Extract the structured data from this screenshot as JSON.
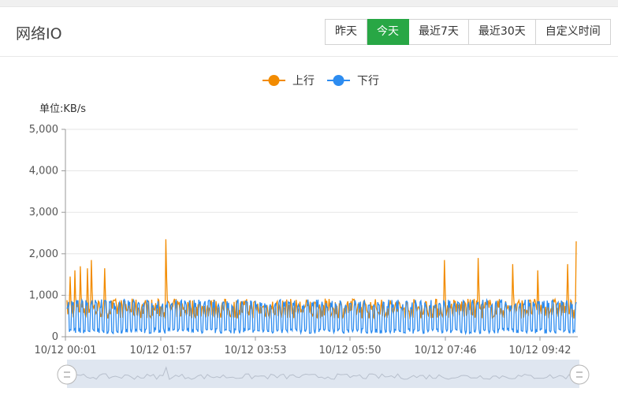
{
  "panel": {
    "title": "网络IO",
    "range_buttons": [
      {
        "label": "昨天",
        "active": false
      },
      {
        "label": "今天",
        "active": true
      },
      {
        "label": "最近7天",
        "active": false
      },
      {
        "label": "最近30天",
        "active": false
      },
      {
        "label": "自定义时间",
        "active": false
      }
    ]
  },
  "colors": {
    "upload": "#f28b00",
    "download": "#2d8cf0",
    "active_button": "#28a745"
  },
  "chart_data": {
    "type": "line",
    "unit_label": "单位:KB/s",
    "legend": [
      {
        "name": "上行",
        "color": "#f28b00"
      },
      {
        "name": "下行",
        "color": "#2d8cf0"
      }
    ],
    "ylim": [
      0,
      5000
    ],
    "y_ticks": [
      "0",
      "1,000",
      "2,000",
      "3,000",
      "4,000",
      "5,000"
    ],
    "x_ticks": [
      "10/12 00:01",
      "10/12 01:57",
      "10/12 03:53",
      "10/12 05:50",
      "10/12 07:46",
      "10/12 09:42"
    ],
    "series": [
      {
        "name": "上行",
        "baseline": 800,
        "spikes": [
          {
            "time": "10/12 00:05",
            "value": 1450
          },
          {
            "time": "10/12 00:10",
            "value": 1600
          },
          {
            "time": "10/12 00:17",
            "value": 1700
          },
          {
            "time": "10/12 00:25",
            "value": 1650
          },
          {
            "time": "10/12 00:30",
            "value": 1850
          },
          {
            "time": "10/12 00:45",
            "value": 1650
          },
          {
            "time": "10/12 01:57",
            "value": 2350
          },
          {
            "time": "10/12 07:25",
            "value": 1850
          },
          {
            "time": "10/12 08:05",
            "value": 1900
          },
          {
            "time": "10/12 08:45",
            "value": 1750
          },
          {
            "time": "10/12 09:15",
            "value": 1600
          },
          {
            "time": "10/12 09:50",
            "value": 1750
          },
          {
            "time": "10/12 10:00",
            "value": 2300
          }
        ]
      },
      {
        "name": "下行",
        "baseline": 600,
        "peak": 900
      }
    ]
  }
}
